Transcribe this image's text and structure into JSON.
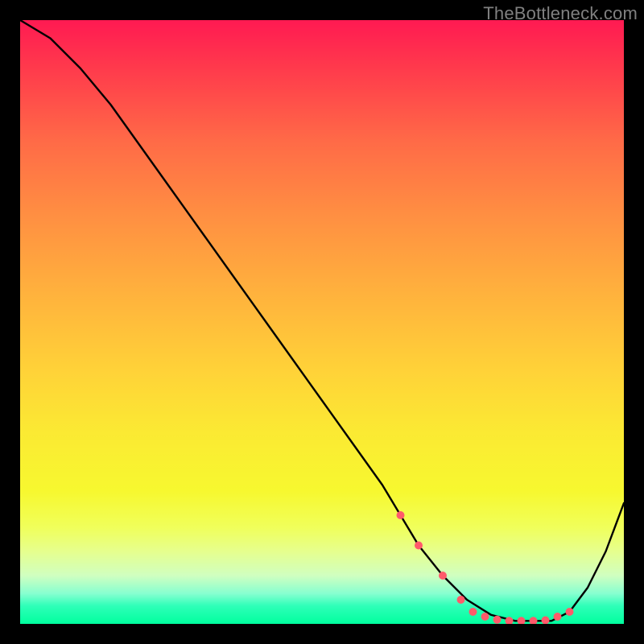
{
  "watermark": "TheBottleneck.com",
  "chart_data": {
    "type": "line",
    "title": "",
    "xlabel": "",
    "ylabel": "",
    "xlim": [
      0,
      100
    ],
    "ylim": [
      0,
      100
    ],
    "grid": false,
    "legend": false,
    "series": [
      {
        "name": "curve",
        "color": "#000000",
        "x": [
          0,
          5,
          10,
          15,
          20,
          25,
          30,
          35,
          40,
          45,
          50,
          55,
          60,
          63,
          66,
          70,
          74,
          78,
          82,
          85,
          88,
          91,
          94,
          97,
          100
        ],
        "values": [
          100,
          97,
          92,
          86,
          79,
          72,
          65,
          58,
          51,
          44,
          37,
          30,
          23,
          18,
          13,
          8,
          4,
          1.5,
          0.5,
          0.5,
          0.5,
          2,
          6,
          12,
          20
        ]
      },
      {
        "name": "highlight-points",
        "type": "scatter",
        "color": "#ff5a6a",
        "x": [
          63,
          66,
          70,
          73,
          75,
          77,
          79,
          81,
          83,
          85,
          87,
          89,
          91
        ],
        "values": [
          18,
          13,
          8,
          4,
          2,
          1.2,
          0.7,
          0.5,
          0.5,
          0.5,
          0.6,
          1.2,
          2
        ]
      }
    ]
  },
  "style": {
    "dot_color": "#ff5a6a",
    "curve_color": "#000000"
  }
}
